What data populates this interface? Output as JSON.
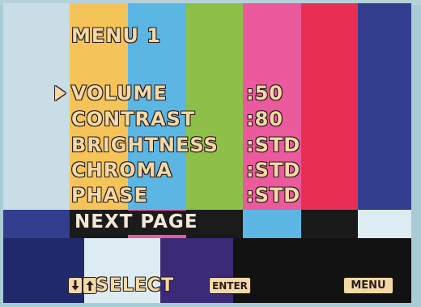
{
  "colors": {
    "bar_gray": "#c8dde6",
    "bar_yellow": "#f5c458",
    "bar_cyan": "#5cb6e4",
    "bar_green": "#8ec049",
    "bar_magenta": "#ea5a9d",
    "bar_red": "#e82e52",
    "bar_blue": "#343e8e",
    "text_fill": "#f3d9a6",
    "text_outline": "#2a1b1b",
    "highlight_bg": "#1b1b1b"
  },
  "menu": {
    "title": "MENU 1",
    "selected_index": 0,
    "items": [
      {
        "label": "VOLUME",
        "value": ":50"
      },
      {
        "label": "CONTRAST",
        "value": ":80"
      },
      {
        "label": "BRIGHTNESS",
        "value": ":STD"
      },
      {
        "label": "CHROMA",
        "value": ":STD"
      },
      {
        "label": "PHASE",
        "value": ":STD"
      }
    ],
    "next_page": "NEXT PAGE"
  },
  "footer": {
    "down_icon": "down-arrow-icon",
    "up_icon": "up-arrow-icon",
    "select_label": "SELECT",
    "enter_key": "ENTER",
    "menu_key": "MENU"
  }
}
